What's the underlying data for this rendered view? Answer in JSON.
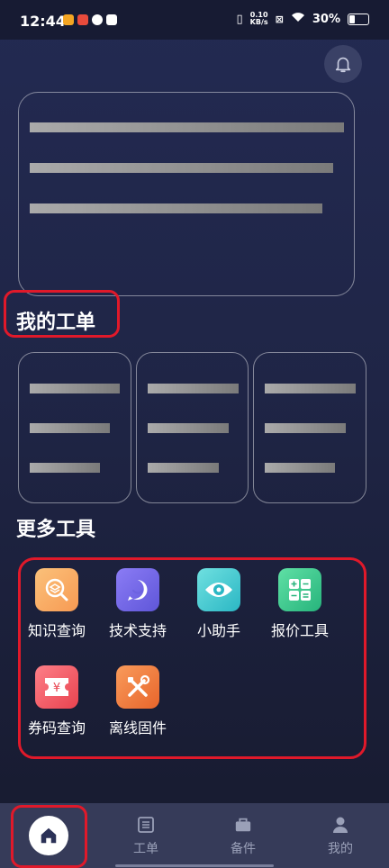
{
  "status_bar": {
    "time": "12:44",
    "speed_top": "0.10",
    "speed_bottom": "KB/s",
    "battery": "30%"
  },
  "header": {
    "bell_icon": "bell-icon"
  },
  "sections": {
    "my_orders": "我的工单",
    "more_tools": "更多工具"
  },
  "tools": [
    {
      "label": "知识查询",
      "icon": "knowledge-search-icon",
      "color_from": "#fbc17a",
      "color_to": "#f79a53"
    },
    {
      "label": "技术支持",
      "icon": "chat-bubble-icon",
      "color_from": "#8b7cf5",
      "color_to": "#5f56d9"
    },
    {
      "label": "小助手",
      "icon": "eye-icon",
      "color_from": "#6fe0e0",
      "color_to": "#2bb7c4"
    },
    {
      "label": "报价工具",
      "icon": "calculator-icon",
      "color_from": "#5fe0a5",
      "color_to": "#27b47c"
    },
    {
      "label": "券码查询",
      "icon": "coupon-icon",
      "color_from": "#fd7f88",
      "color_to": "#e9434f"
    },
    {
      "label": "离线固件",
      "icon": "tools-icon",
      "color_from": "#f99b5b",
      "color_to": "#e8652b"
    }
  ],
  "bottom_nav": {
    "home_icon": "home-icon",
    "orders": "工单",
    "parts": "备件",
    "mine": "我的"
  },
  "colors": {
    "highlight": "#e0192a",
    "background": "#1f2546",
    "nav": "#363b59"
  }
}
